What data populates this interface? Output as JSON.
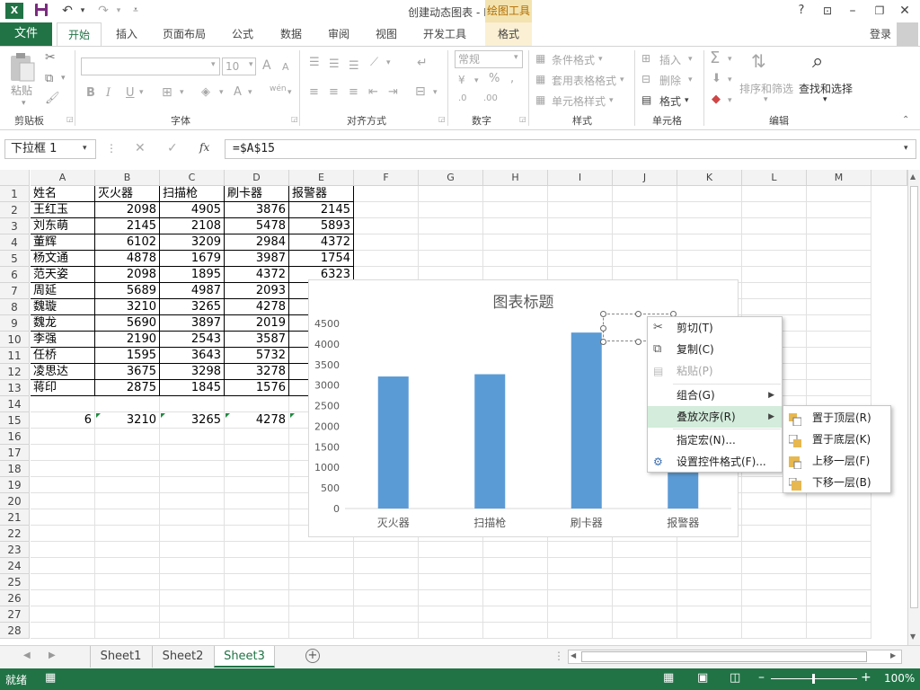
{
  "window": {
    "title": "创建动态图表 - Excel",
    "context_tab_group": "绘图工具",
    "help": "?",
    "login": "登录"
  },
  "tabs": [
    "文件",
    "开始",
    "插入",
    "页面布局",
    "公式",
    "数据",
    "审阅",
    "视图",
    "开发工具",
    "格式"
  ],
  "ribbon": {
    "clipboard": {
      "paste": "粘贴",
      "label": "剪贴板"
    },
    "font": {
      "label": "字体",
      "size": "10",
      "bold": "B",
      "italic": "I",
      "underline": "U",
      "font_color": "A",
      "grow": "A",
      "shrink": "A",
      "phonetic": "wén"
    },
    "alignment": {
      "label": "对齐方式"
    },
    "number": {
      "label": "数字",
      "format": "常规",
      "percent": "%"
    },
    "styles": {
      "label": "样式",
      "cond": "条件格式",
      "table": "套用表格格式",
      "cell": "单元格样式"
    },
    "cells": {
      "label": "单元格",
      "insert": "插入",
      "delete": "删除",
      "format": "格式"
    },
    "editing": {
      "label": "编辑",
      "sort": "排序和筛选",
      "find": "查找和选择",
      "sum": "Σ"
    }
  },
  "formula_bar": {
    "name_box": "下拉框 1",
    "formula": "=$A$15",
    "fx": "fx"
  },
  "columns": [
    "A",
    "B",
    "C",
    "D",
    "E",
    "F",
    "G",
    "H",
    "I",
    "J",
    "K",
    "L",
    "M"
  ],
  "rows": [
    "1",
    "2",
    "3",
    "4",
    "5",
    "6",
    "7",
    "8",
    "9",
    "10",
    "11",
    "12",
    "13",
    "14",
    "15",
    "16",
    "17",
    "18",
    "19",
    "20",
    "21",
    "22",
    "23",
    "24",
    "25",
    "26",
    "27",
    "28"
  ],
  "table": {
    "headers": [
      "姓名",
      "灭火器",
      "扫描枪",
      "刷卡器",
      "报警器"
    ],
    "rows": [
      [
        "王红玉",
        "2098",
        "4905",
        "3876",
        "2145"
      ],
      [
        "刘东萌",
        "2145",
        "2108",
        "5478",
        "5893"
      ],
      [
        "董辉",
        "6102",
        "3209",
        "2984",
        "4372"
      ],
      [
        "杨文通",
        "4878",
        "1679",
        "3987",
        "1754"
      ],
      [
        "范天姿",
        "2098",
        "1895",
        "4372",
        "6323"
      ],
      [
        "周延",
        "5689",
        "4987",
        "2093",
        ""
      ],
      [
        "魏璇",
        "3210",
        "3265",
        "4278",
        ""
      ],
      [
        "魏龙",
        "5690",
        "3897",
        "2019",
        ""
      ],
      [
        "李强",
        "2190",
        "2543",
        "3587",
        ""
      ],
      [
        "任桥",
        "1595",
        "3643",
        "5732",
        ""
      ],
      [
        "凌思达",
        "3675",
        "3298",
        "3278",
        ""
      ],
      [
        "蒋印",
        "2875",
        "1845",
        "1576",
        ""
      ]
    ],
    "row15": [
      "6",
      "3210",
      "3265",
      "4278"
    ]
  },
  "chart_data": {
    "type": "bar",
    "title": "图表标题",
    "categories": [
      "灭火器",
      "扫描枪",
      "刷卡器",
      "报警器"
    ],
    "values": [
      3210,
      3265,
      4278,
      0
    ],
    "ylim": [
      0,
      4500
    ],
    "yticks": [
      "0",
      "500",
      "1000",
      "1500",
      "2000",
      "2500",
      "3000",
      "3500",
      "4000",
      "4500"
    ],
    "bar_color": "#5b9bd5",
    "grid": false
  },
  "context_menu": {
    "items": [
      {
        "label": "剪切(T)",
        "icon": "scissors-icon",
        "enabled": true
      },
      {
        "label": "复制(C)",
        "icon": "copy-icon",
        "enabled": true
      },
      {
        "label": "粘贴(P)",
        "icon": "paste-icon",
        "enabled": false
      },
      {
        "label": "组合(G)",
        "icon": "",
        "enabled": true,
        "submenu": true
      },
      {
        "label": "叠放次序(R)",
        "icon": "",
        "enabled": true,
        "submenu": true,
        "highlighted": true
      },
      {
        "label": "指定宏(N)...",
        "icon": "",
        "enabled": true
      },
      {
        "label": "设置控件格式(F)...",
        "icon": "format-control-icon",
        "enabled": true
      }
    ],
    "submenu": [
      "置于顶层(R)",
      "置于底层(K)",
      "上移一层(F)",
      "下移一层(B)"
    ]
  },
  "sheets": [
    "Sheet1",
    "Sheet2",
    "Sheet3"
  ],
  "active_sheet": "Sheet3",
  "status": {
    "ready": "就绪",
    "zoom": "100%"
  },
  "colors": {
    "excel_green": "#217346",
    "highlight": "#d3ecdb",
    "bar": "#5b9bd5"
  }
}
